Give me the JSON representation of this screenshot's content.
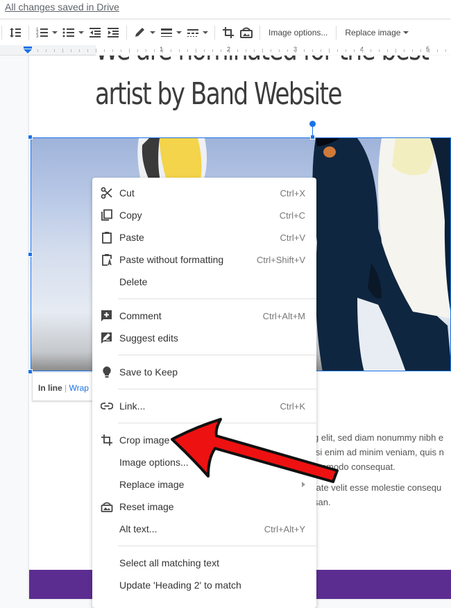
{
  "status": {
    "saved_text": "All changes saved in Drive"
  },
  "toolbar": {
    "image_options_label": "Image options...",
    "replace_image_label": "Replace image"
  },
  "ruler": {
    "numbers": [
      "1",
      "2",
      "3",
      "4",
      "5"
    ]
  },
  "document": {
    "heading_line1": "We are nominated for the best",
    "heading_line2": "artist by Band Website",
    "image_alt": "Two emperor penguins",
    "wrap_options": {
      "inline": "In line",
      "separator": "|",
      "wrap": "Wrap"
    },
    "body_lines": [
      "g elit, sed diam nonummy nibh e",
      "isi enim ad minim veniam, quis n",
      "ommodo consequat.",
      "tate velit esse molestie consequ",
      "san."
    ],
    "footer_band_color": "#5c2d91"
  },
  "context_menu": {
    "items": [
      {
        "label": "Cut",
        "shortcut": "Ctrl+X",
        "icon": "scissors-icon"
      },
      {
        "label": "Copy",
        "shortcut": "Ctrl+C",
        "icon": "copy-icon"
      },
      {
        "label": "Paste",
        "shortcut": "Ctrl+V",
        "icon": "clipboard-icon"
      },
      {
        "label": "Paste without formatting",
        "shortcut": "Ctrl+Shift+V",
        "icon": "clipboard-text-icon"
      },
      {
        "label": "Delete",
        "shortcut": ""
      },
      {
        "label": "Comment",
        "shortcut": "Ctrl+Alt+M",
        "icon": "add-comment-icon"
      },
      {
        "label": "Suggest edits",
        "shortcut": "",
        "icon": "suggest-edit-icon"
      },
      {
        "label": "Save to Keep",
        "shortcut": "",
        "icon": "lightbulb-icon"
      },
      {
        "label": "Link...",
        "shortcut": "Ctrl+K",
        "icon": "link-icon"
      },
      {
        "label": "Crop image",
        "shortcut": "",
        "icon": "crop-icon"
      },
      {
        "label": "Image options...",
        "shortcut": ""
      },
      {
        "label": "Replace image",
        "shortcut": "",
        "submenu": true
      },
      {
        "label": "Reset image",
        "shortcut": "",
        "icon": "reset-image-icon"
      },
      {
        "label": "Alt text...",
        "shortcut": "Ctrl+Alt+Y"
      },
      {
        "label": "Select all matching text",
        "shortcut": ""
      },
      {
        "label": "Update 'Heading 2' to match",
        "shortcut": ""
      }
    ]
  },
  "annotation": {
    "arrow_color": "#ee1111",
    "points_to": "Crop image"
  }
}
